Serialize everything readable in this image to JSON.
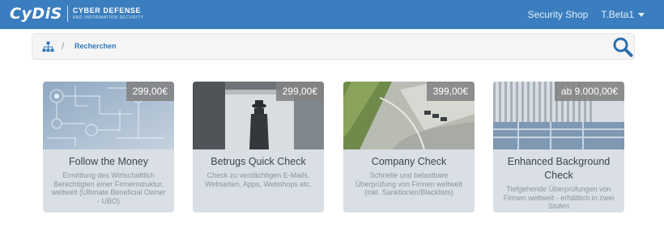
{
  "header": {
    "logo_text": "CyDiS",
    "logo_line1": "CYBER DEFENSE",
    "logo_line2": "AND INFORMATION SECURITY",
    "nav_shop": "Security Shop",
    "user_name": "T.Beta1"
  },
  "breadcrumb": {
    "home_icon": "sitemap-icon",
    "separator": "/",
    "current": "Recherchen",
    "search_icon": "search-icon"
  },
  "colors": {
    "topbar": "#3a7ebf",
    "link": "#2f78b8",
    "card_bg": "#d9dfe4"
  },
  "cards": [
    {
      "title": "Follow the Money",
      "description": "Ermittlung des Wirtschaftlich Berechtigten einer Firmenstruktur, weltweit (Ultimate Beneficial Owner - UBO)",
      "price": "299,00€"
    },
    {
      "title": "Betrugs Quick Check",
      "description": "Check zu verdächtigen E-Mails, Webseiten, Apps, Webshops etc.",
      "price": "299,00€"
    },
    {
      "title": "Company Check",
      "description": "Schnelle und belastbare Überprüfung von Firmen weltweit (inkl. Sanktionen/Blacklists)",
      "price": "399,00€"
    },
    {
      "title": "Enhanced Background Check",
      "description": "Tiefgehende Überprüfungen von Firmen weltweit - erhältlich in zwei Stufen",
      "price": "ab 9.000,00€"
    }
  ]
}
